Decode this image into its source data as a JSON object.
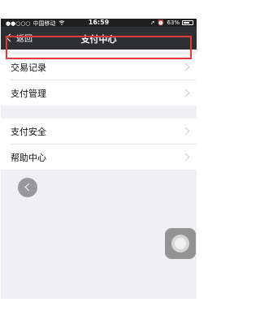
{
  "status_bar": {
    "carrier": "中国移动",
    "time": "16:59",
    "battery": "63%"
  },
  "nav": {
    "back_label": "返回",
    "title": "支付中心"
  },
  "groups": [
    {
      "items": [
        {
          "label": "交易记录"
        },
        {
          "label": "支付管理"
        }
      ]
    },
    {
      "items": [
        {
          "label": "支付安全"
        },
        {
          "label": "帮助中心"
        }
      ]
    }
  ],
  "colors": {
    "nav_background": "#2e2f32",
    "highlight_border": "#e23a3a",
    "page_background": "#efeff4"
  },
  "icons": {
    "wifi": "wifi-icon",
    "alarm": "alarm-icon",
    "location": "location-icon",
    "back": "chevron-left-icon",
    "row_chevron": "chevron-right-icon",
    "assistive_touch": "assistive-touch-icon"
  }
}
